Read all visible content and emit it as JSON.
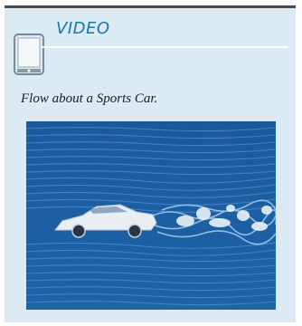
{
  "header": {
    "title": "VIDEO"
  },
  "caption": "Flow about a Sports Car.",
  "icons": {
    "device": "handheld-device-icon"
  },
  "video": {
    "subject": "sports-car-flow-visualization"
  },
  "colors": {
    "panel_background": "#dcebf3",
    "title_color": "#1578a8",
    "video_background": "#1b5e9f",
    "top_rule": "#4a4a4a"
  }
}
